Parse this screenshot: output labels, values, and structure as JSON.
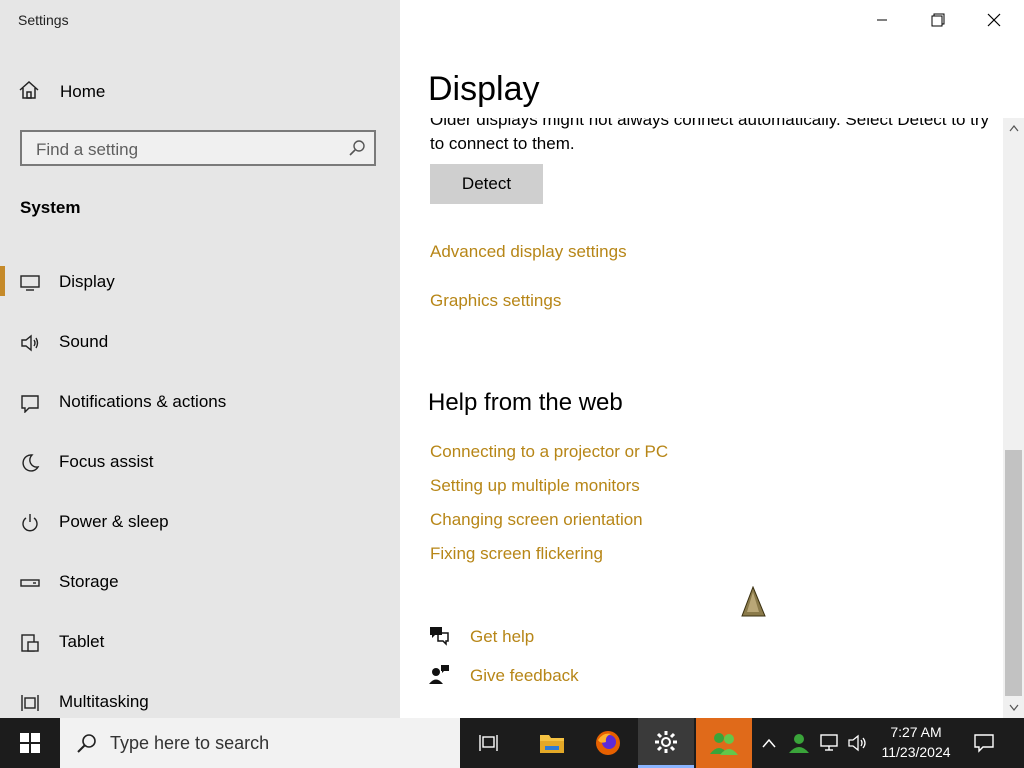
{
  "window": {
    "app_title": "Settings"
  },
  "sidebar": {
    "home_label": "Home",
    "search_placeholder": "Find a setting",
    "section_title": "System",
    "items": [
      {
        "label": "Display",
        "icon": "monitor-icon",
        "selected": true
      },
      {
        "label": "Sound",
        "icon": "speaker-icon"
      },
      {
        "label": "Notifications & actions",
        "icon": "notification-icon"
      },
      {
        "label": "Focus assist",
        "icon": "moon-icon"
      },
      {
        "label": "Power & sleep",
        "icon": "power-icon"
      },
      {
        "label": "Storage",
        "icon": "storage-icon"
      },
      {
        "label": "Tablet",
        "icon": "tablet-icon"
      },
      {
        "label": "Multitasking",
        "icon": "multitasking-icon"
      }
    ]
  },
  "main": {
    "page_title": "Display",
    "clipped_text": "Older displays might not always connect automatically. Select Detect to try to connect to them.",
    "detect_button": "Detect",
    "links": [
      "Advanced display settings",
      "Graphics settings"
    ],
    "help_title": "Help from the web",
    "help_links": [
      "Connecting to a projector or PC",
      "Setting up multiple monitors",
      "Changing screen orientation",
      "Fixing screen flickering"
    ],
    "get_help": "Get help",
    "give_feedback": "Give feedback"
  },
  "taskbar": {
    "search_placeholder": "Type here to search",
    "time": "7:27 AM",
    "date": "11/23/2024"
  },
  "colors": {
    "accent": "#b78617",
    "selection": "#c58a2a",
    "sidebar_bg": "#e6e6e6",
    "taskbar_bg": "#1c1c1c"
  }
}
